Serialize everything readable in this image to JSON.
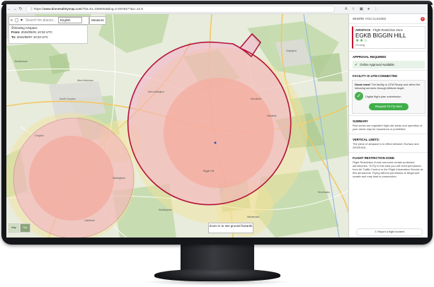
{
  "browser": {
    "url_prefix": "https://",
    "url_domain": "www.dronesafetymap.com",
    "url_rest": "/?lat=51.3355053&lng=0.0578477&z=12.9",
    "nav_icons": [
      "back-icon",
      "forward-icon",
      "reload-icon",
      "info-icon"
    ],
    "right_icons": [
      "translate-icon",
      "star-icon",
      "extensions-icon",
      "profile-icon",
      "menu-icon"
    ]
  },
  "map": {
    "search_placeholder": "Search for places...",
    "language": "English",
    "measure_label": "Measure",
    "viewing_title": "Viewing Airspace",
    "from_label": "From:",
    "from_value": "2024/05/31 10:32 UTC",
    "to_label": "To:",
    "to_value": "2024/06/07 10:32 UTC",
    "zoom_hint": "Zoom in to see ground hazards",
    "layer_buttons": [
      "Map",
      "Sat"
    ],
    "place_labels": [
      "Beckenham",
      "West Wickham",
      "New Addington",
      "Biggin Hill",
      "Sevenoaks",
      "Orpington",
      "Croydon",
      "South Croydon",
      "Halstead",
      "Warlingham",
      "Westerham",
      "Caterham",
      "Knockholt",
      "Woldingham"
    ]
  },
  "panel": {
    "header": "WHERE YOU CLICKED",
    "airspace_type_bold": "AIRSPACE",
    "airspace_type_rest": " - Flight Restriction Zone",
    "airspace_name": "EGKB BIGGIN HILL",
    "stars": "★★☆",
    "stars_caption": "2/3 rating",
    "approval_title": "APPROVAL REQUIRED",
    "approval_text": "Online Approval Available",
    "utm_title": "FACILITY IS UTM CONNECTED",
    "utm_text_bold": "Good news!",
    "utm_text": " The facility is UTM Ready and offers the following services through Altitude Angel:",
    "utm_service": "Digital flight plan submission",
    "request_button": "Request To Fly Here",
    "summary_title": "SUMMARY",
    "summary_text": "Red zones are regulated high-risk areas and operation of your drone may be hazardous or prohibited.",
    "vertical_title": "VERTICAL LIMITS:",
    "vertical_text": "The piece of airspace is in effect between Surface and 2000ft AGL.",
    "frz_title": "FLIGHT RESTRICTION ZONE",
    "frz_text": "Flight Restriction Zones surround certain protected aerodromes. To Fly in this area you will need permission from Air Traffic Control or the Flight Information Service at this aerodrome. Flying without permission is illegal and unsafe and may lead to prosecution.",
    "report_button": "Report a flight incident"
  },
  "colors": {
    "frz_fill": "#f3a8c4",
    "frz_stroke": "#b3123a",
    "orange_fill": "#f7b07a",
    "yellow_fill": "#f4e39a",
    "accent_green": "#3fae49"
  }
}
